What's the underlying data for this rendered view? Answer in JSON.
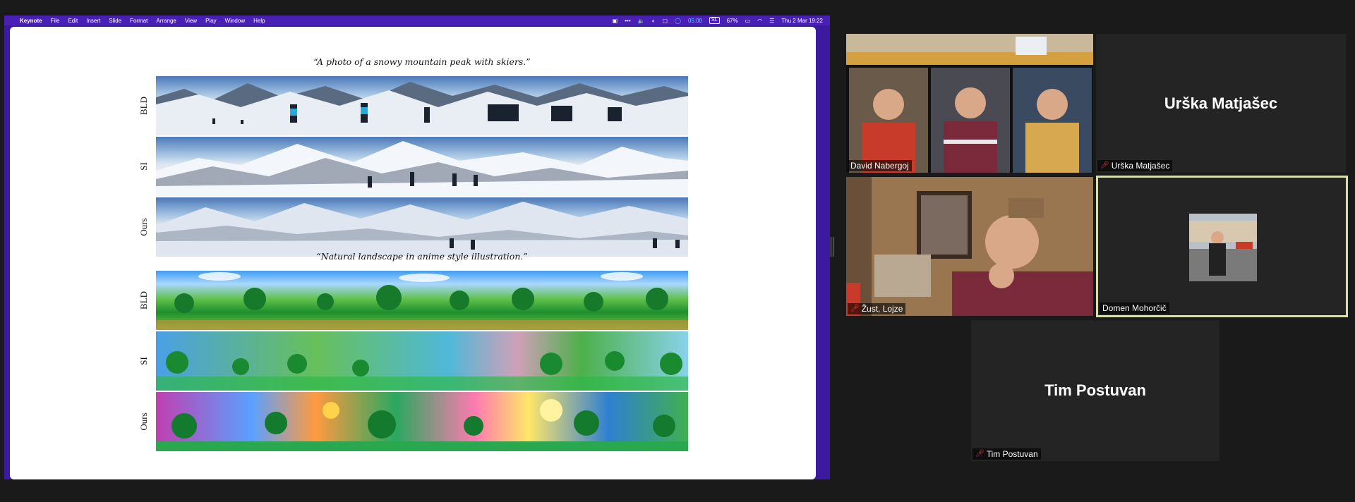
{
  "menubar": {
    "apple_glyph": "",
    "app": "Keynote",
    "items": [
      "File",
      "Edit",
      "Insert",
      "Slide",
      "Format",
      "Arrange",
      "View",
      "Play",
      "Window",
      "Help"
    ],
    "timer": "05:00",
    "lang": "SL",
    "battery": "67%",
    "datetime": "Thu 2 Mar  19:22"
  },
  "slide": {
    "caption1": "“A photo of a snowy mountain peak with skiers.”",
    "caption2": "“Natural landscape in anime style illustration.”",
    "rows": [
      "BLD",
      "SI",
      "Ours"
    ]
  },
  "participants": {
    "david": "David Nabergoj",
    "urska": "Urška Matjašec",
    "zust": "Žust, Lojze",
    "domen": "Domen Mohorčič",
    "tim": "Tim Postuvan"
  },
  "colors": {
    "active_speaker_border": "#d8e58a",
    "muted_icon": "#ff3b30",
    "tile_bg": "#242424"
  }
}
